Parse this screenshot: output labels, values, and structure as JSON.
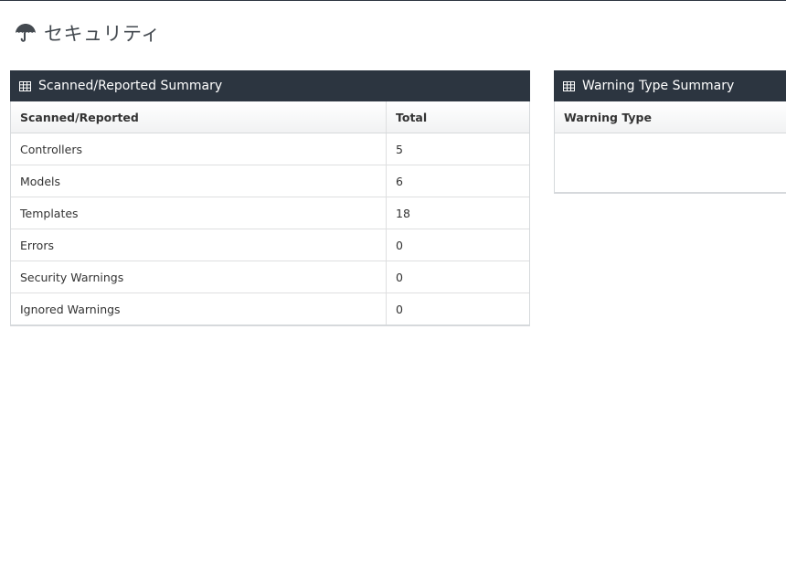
{
  "header": {
    "icon": "umbrella-icon",
    "title": "セキュリティ"
  },
  "summary_panel": {
    "icon": "table-icon",
    "title": "Scanned/Reported Summary",
    "columns": [
      "Scanned/Reported",
      "Total"
    ],
    "rows": [
      {
        "label": "Controllers",
        "total": "5"
      },
      {
        "label": "Models",
        "total": "6"
      },
      {
        "label": "Templates",
        "total": "18"
      },
      {
        "label": "Errors",
        "total": "0"
      },
      {
        "label": "Security Warnings",
        "total": "0"
      },
      {
        "label": "Ignored Warnings",
        "total": "0"
      }
    ]
  },
  "warning_panel": {
    "icon": "table-icon",
    "title": "Warning Type Summary",
    "columns": [
      "Warning Type"
    ],
    "rows": []
  },
  "colors": {
    "panel_header_bg": "#2c3540",
    "panel_header_text": "#ffffff",
    "border": "#d6d9dc"
  }
}
